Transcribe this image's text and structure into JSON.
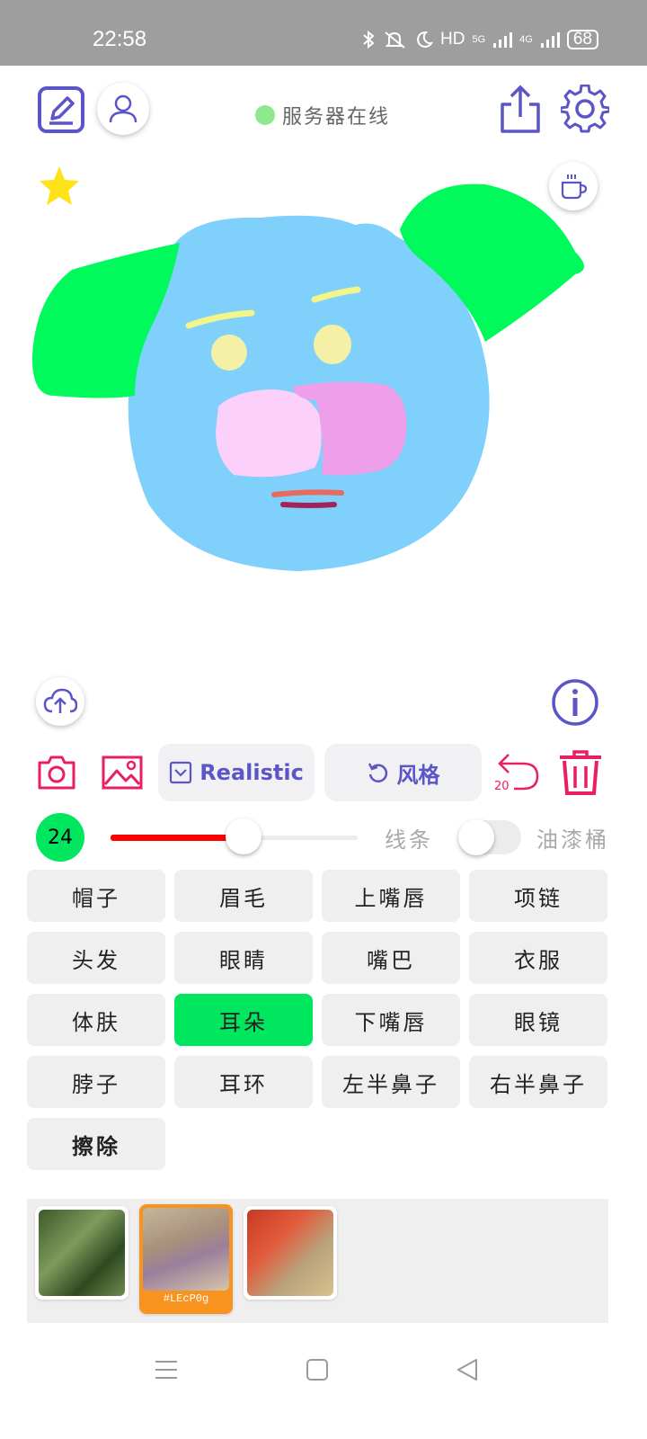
{
  "status_bar": {
    "time": "22:58",
    "network_hd": "HD",
    "net_5g": "5G",
    "net_4g": "4G",
    "battery": "68"
  },
  "header": {
    "server_status": "服务器在线",
    "server_status_color": "#8ee98e"
  },
  "toolbar": {
    "realistic_label": "Realistic",
    "style_label": "风格",
    "undo_count": "20"
  },
  "brush": {
    "size": "24",
    "slider_value_fraction": 0.54,
    "line_label": "线条",
    "bucket_label": "油漆桶",
    "bucket_enabled": false
  },
  "parts": [
    {
      "label": "帽子"
    },
    {
      "label": "眉毛"
    },
    {
      "label": "上嘴唇"
    },
    {
      "label": "项链"
    },
    {
      "label": "头发"
    },
    {
      "label": "眼睛"
    },
    {
      "label": "嘴巴"
    },
    {
      "label": "衣服"
    },
    {
      "label": "体肤"
    },
    {
      "label": "耳朵",
      "selected": true
    },
    {
      "label": "下嘴唇"
    },
    {
      "label": "眼镜"
    },
    {
      "label": "脖子"
    },
    {
      "label": "耳环"
    },
    {
      "label": "左半鼻子"
    },
    {
      "label": "右半鼻子"
    },
    {
      "label": "擦除"
    }
  ],
  "gallery": {
    "selected_caption": "#LEcP0g"
  },
  "colors": {
    "accent": "#5b55c8",
    "danger": "#e91e63",
    "selected_part": "#00e65f",
    "slider": "#ff0000"
  }
}
